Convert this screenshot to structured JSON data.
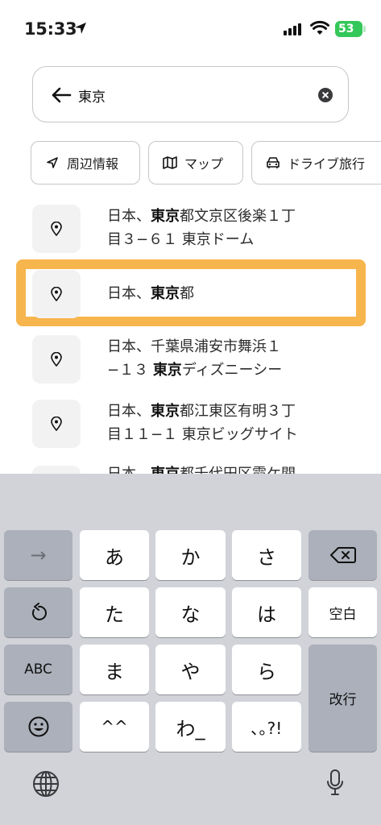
{
  "status": {
    "time": "15:33",
    "battery": "53"
  },
  "search": {
    "value": "東京"
  },
  "chips": [
    {
      "label": "周辺情報",
      "icon": "navigation-arrow-icon"
    },
    {
      "label": "マップ",
      "icon": "map-icon"
    },
    {
      "label": "ドライブ旅行",
      "icon": "car-icon"
    }
  ],
  "results": [
    {
      "line1": {
        "pre": "日本、",
        "bold": "東京",
        "post": "都文京区後楽１丁"
      },
      "line2": {
        "pre": "目３−６１ 東京ドーム",
        "bold": "",
        "post": ""
      }
    },
    {
      "line1": {
        "pre": "日本、",
        "bold": "東京",
        "post": "都"
      },
      "line2": null
    },
    {
      "line1": {
        "pre": "日本、千葉県浦安市舞浜１",
        "bold": "",
        "post": ""
      },
      "line2": {
        "pre": "−１３ ",
        "bold": "東京",
        "post": "ディズニーシー"
      }
    },
    {
      "line1": {
        "pre": "日本、",
        "bold": "東京",
        "post": "都江東区有明３丁"
      },
      "line2": {
        "pre": "目１１−１ 東京ビッグサイト",
        "bold": "",
        "post": ""
      }
    },
    {
      "line1": {
        "pre": "日本、",
        "bold": "東京",
        "post": "都千代田区霞ケ関"
      },
      "line2": null
    }
  ],
  "keyboard": {
    "row1": [
      "→",
      "あ",
      "か",
      "さ",
      "⌫"
    ],
    "row2": [
      "↺",
      "た",
      "な",
      "は",
      "空白"
    ],
    "row3": [
      "ABC",
      "ま",
      "や",
      "ら"
    ],
    "enter": "改行",
    "row4": [
      "☺",
      "^^",
      "わ_",
      "､｡?!"
    ]
  }
}
